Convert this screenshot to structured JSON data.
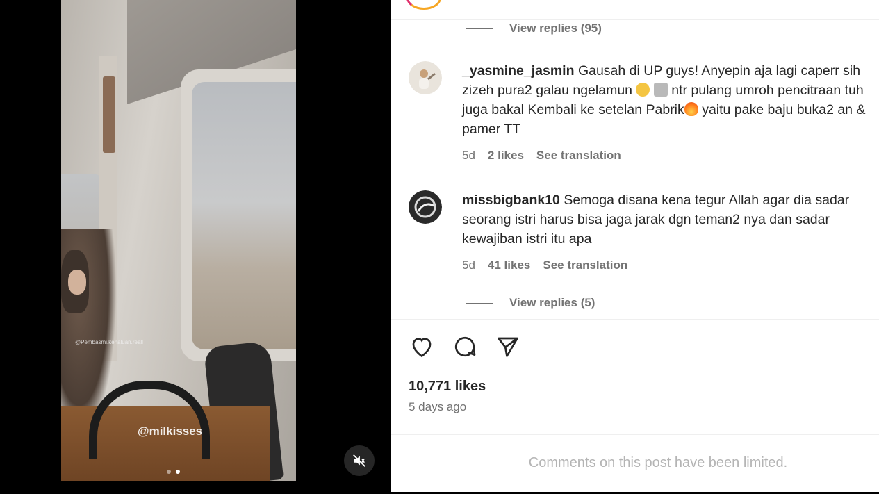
{
  "media": {
    "overlay_handle": "@Pembasmi.kehaluan.reall",
    "watermark": "@milkisses",
    "carousel_dots": 2,
    "active_dot": 2,
    "mute_icon": "muted-speaker-icon"
  },
  "comments_top": {
    "view_replies": "View replies (95)"
  },
  "comments": [
    {
      "username": "_yasmine_jasmin",
      "text_parts": [
        "Gausah di UP guys! Anyepin aja lagi caperr sih zizeh pura2 galau ngelamun ",
        " ",
        " ntr pulang umroh pencitraan tuh juga bakal Kembali ke setelan Pabrik",
        " yaitu pake baju buka2 an & pamer TT"
      ],
      "emojis": [
        "rolling-laughing-emoji",
        "sticker-emoji",
        "fire-emoji"
      ],
      "age": "5d",
      "likes": "2 likes",
      "see_translation": "See translation"
    },
    {
      "username": "missbigbank10",
      "text": "Semoga disana kena tegur Allah agar dia sadar seorang istri harus bisa jaga jarak dgn teman2 nya dan sadar kewajiban istri itu apa",
      "age": "5d",
      "likes": "41 likes",
      "see_translation": "See translation",
      "view_replies": "View replies (5)"
    }
  ],
  "post": {
    "likes": "10,771 likes",
    "time": "5 days ago",
    "limited_notice": "Comments on this post have been limited."
  },
  "colors": {
    "muted_text": "#737373",
    "text": "#262626",
    "divider": "#efefef"
  }
}
